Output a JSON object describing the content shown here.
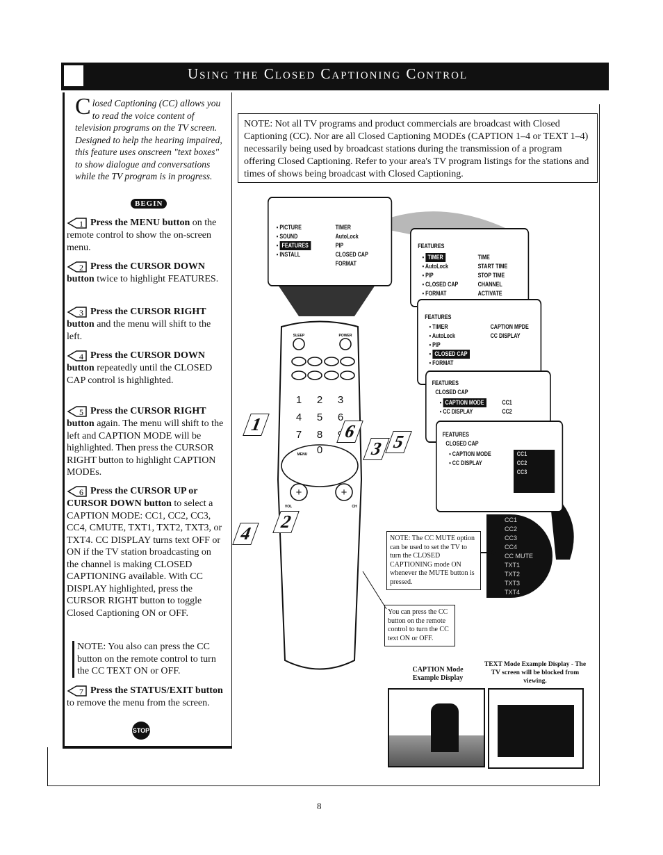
{
  "header": {
    "title": "Using the Closed Captioning Control"
  },
  "intro": {
    "drop_cap": "C",
    "text": "losed Captioning (CC) allows you to read the voice content of television programs on the TV screen. Designed to help the hearing impaired, this feature uses onscreen \"text boxes\" to show dialogue and conversations while the TV program is in progress."
  },
  "begin_label": "BEGIN",
  "steps": [
    {
      "num": "1",
      "bold": "Press the MENU button",
      "text": " on the remote control to show the on-screen menu."
    },
    {
      "num": "2",
      "bold": "Press the CURSOR DOWN button",
      "text": " twice to highlight FEATURES."
    },
    {
      "num": "3",
      "bold": "Press the CURSOR RIGHT button",
      "text": " and the menu will shift to the left."
    },
    {
      "num": "4",
      "bold": "Press the CURSOR DOWN button",
      "text": " repeatedly until the CLOSED CAP control is highlighted."
    },
    {
      "num": "5",
      "bold": "Press the CURSOR RIGHT button",
      "text": " again. The menu will shift to the left and CAPTION MODE will be highlighted. Then press the CURSOR RIGHT button to highlight CAPTION MODEs."
    },
    {
      "num": "6",
      "bold": "Press the CURSOR UP or CURSOR DOWN button",
      "text": " to select a CAPTION MODE: CC1, CC2, CC3, CC4, CMUTE, TXT1, TXT2, TXT3, or TXT4. CC DISPLAY turns text OFF or ON if the TV station broadcasting on the channel is making CLOSED CAPTIONING available. With CC DISPLAY highlighted, press the CURSOR RIGHT button to toggle Closed Captioning ON or OFF."
    },
    {
      "num": "7",
      "bold": "Press the STATUS/EXIT button",
      "text": " to remove the menu from the screen."
    }
  ],
  "left_note": "NOTE: You also can press the CC button on the remote control to turn the CC TEXT ON or OFF.",
  "stop_label": "STOP",
  "top_note": "NOTE: Not all TV programs and product commercials are broadcast with Closed Captioning (CC). Nor are all Closed Captioning MODEs (CAPTION 1–4 or TEXT 1–4) necessarily being used by broadcast stations during the transmission of a program offering Closed Captioning. Refer to your area's TV program listings for the stations and times of shows being broadcast with Closed Captioning.",
  "menus": {
    "main": {
      "left": [
        "PICTURE",
        "SOUND",
        "FEATURES",
        "INSTALL"
      ],
      "right": [
        "TIMER",
        "AutoLock",
        "PIP",
        "CLOSED CAP",
        "FORMAT"
      ]
    },
    "features1": {
      "title": "FEATURES",
      "left": [
        "TIMER",
        "AutoLock",
        "PIP",
        "CLOSED CAP",
        "FORMAT"
      ],
      "right": [
        "TIME",
        "START TIME",
        "STOP TIME",
        "CHANNEL",
        "ACTIVATE"
      ]
    },
    "features2": {
      "title": "FEATURES",
      "left": [
        "TIMER",
        "AutoLock",
        "PIP",
        "CLOSED CAP",
        "FORMAT"
      ],
      "right": [
        "CAPTION MPDE",
        "CC DISPLAY"
      ]
    },
    "features3": {
      "title": "FEATURES",
      "sub": "CLOSED CAP",
      "left": [
        "CAPTION MODE",
        "CC DISPLAY"
      ],
      "right": [
        "CC1",
        "CC2"
      ]
    },
    "features4": {
      "title": "FEATURES",
      "sub": "CLOSED CAP",
      "left": [
        "CAPTION MODE",
        "CC DISPLAY"
      ],
      "right": [
        "CC1",
        "CC2",
        "CC3"
      ]
    }
  },
  "cc_modes": [
    "CC1",
    "CC2",
    "CC3",
    "CC4",
    "CC MUTE",
    "TXT1",
    "TXT2",
    "TXT3",
    "TXT4"
  ],
  "mute_note": "NOTE: The CC MUTE option can be used to set the TV to turn the CLOSED CAPTIONING mode ON whenever the MUTE button is pressed.",
  "cc_note": "You can press the CC button on the remote control to turn the CC text ON or OFF.",
  "caption_example": "CAPTION Mode Example Display",
  "text_example": "TEXT Mode Example Display - The TV screen will be blocked from viewing.",
  "remote": {
    "keys": [
      "1",
      "2",
      "3",
      "4",
      "5",
      "6",
      "7",
      "8",
      "9",
      "0"
    ],
    "labels": {
      "sleep": "SLEEP",
      "power": "POWER",
      "menu": "MENU",
      "vol": "VOL",
      "ch": "CH"
    }
  },
  "callouts": [
    "1",
    "2",
    "3",
    "4",
    "5",
    "6"
  ],
  "page_number": "8"
}
